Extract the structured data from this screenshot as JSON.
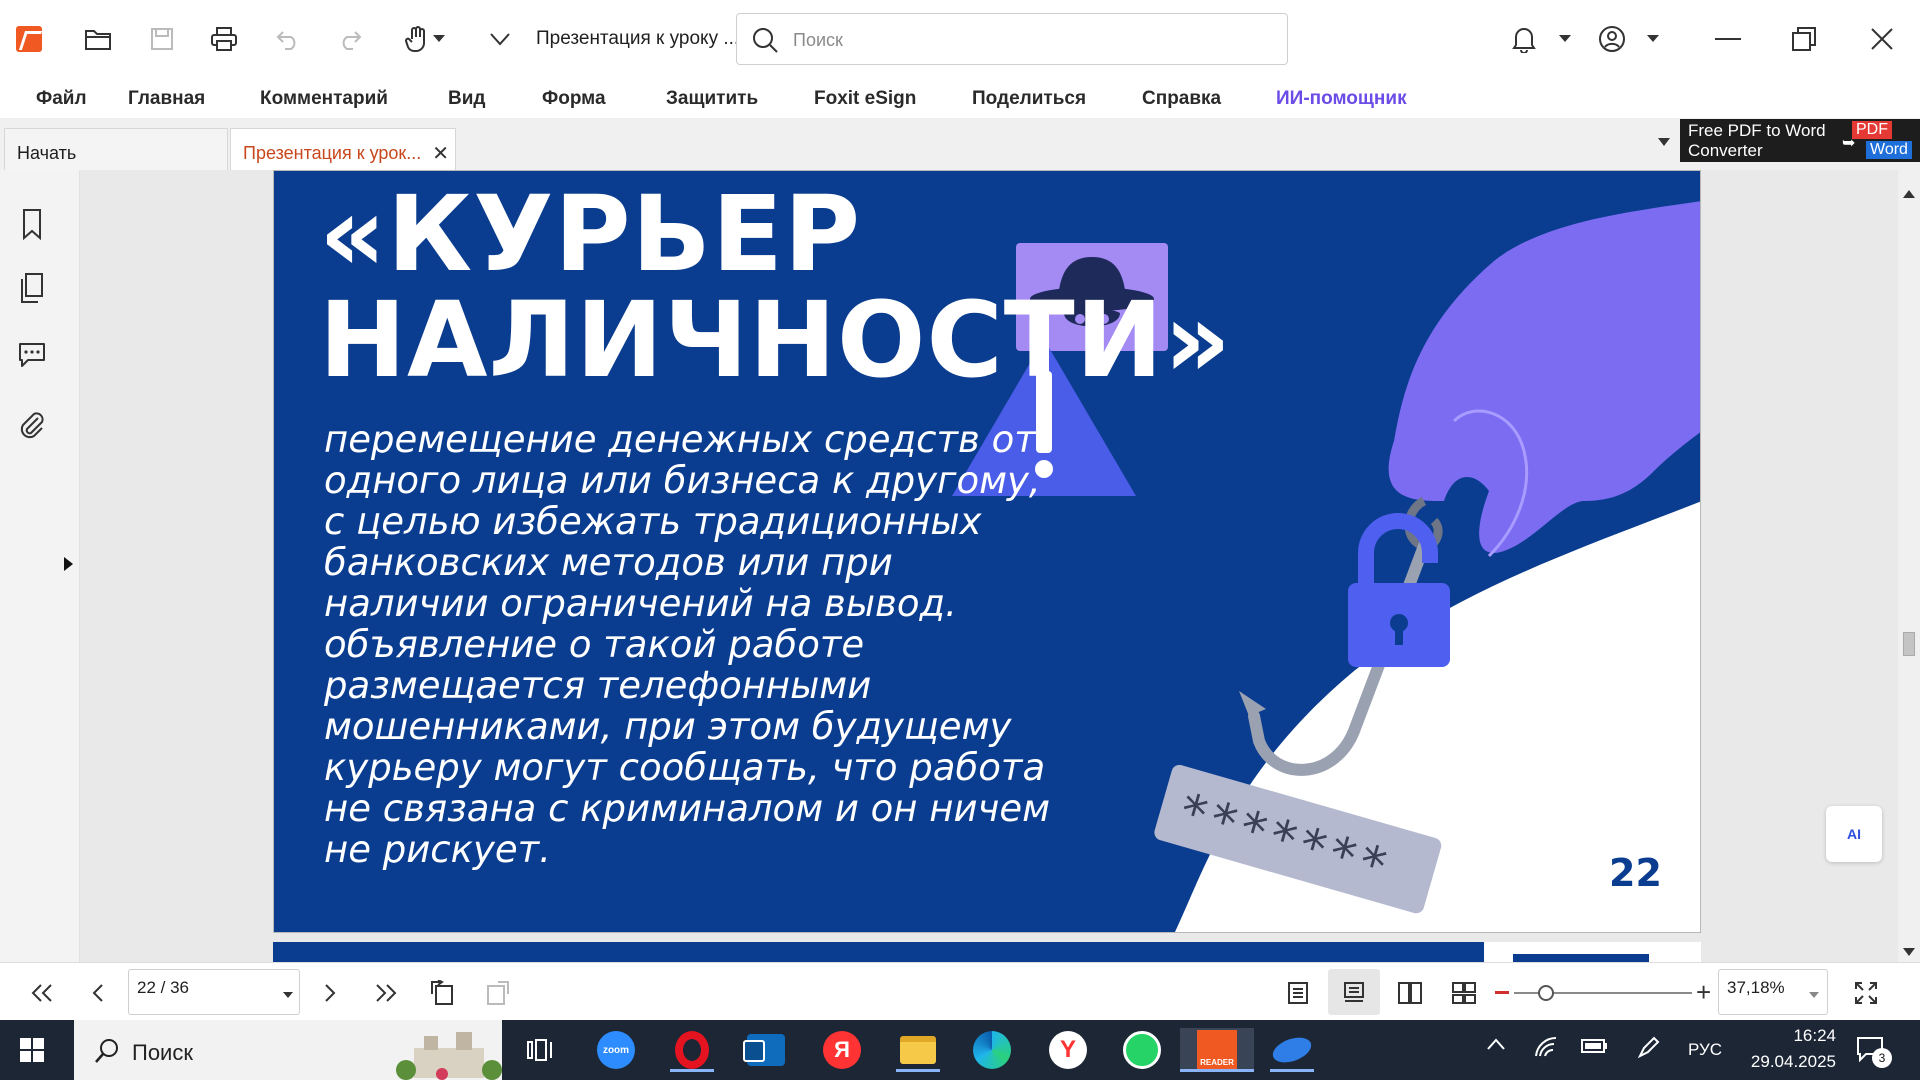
{
  "titlebar": {
    "document_title": "Презентация к уроку ...",
    "search_placeholder": "Поиск"
  },
  "menu": {
    "items": [
      "Файл",
      "Главная",
      "Комментарий",
      "Вид",
      "Форма",
      "Защитить",
      "Foxit eSign",
      "Поделиться",
      "Справка",
      "ИИ-помощник"
    ]
  },
  "tabs": [
    {
      "label": "Начать"
    },
    {
      "label": "Презентация к урок..."
    }
  ],
  "ad": {
    "text": "Free PDF to Word Converter",
    "pdf_label": "PDF",
    "word_label": "Word"
  },
  "slide": {
    "title_line1": "«КУРЬЕР",
    "title_line2": "НАЛИЧНОСТИ»",
    "body": "перемещение денежных средств от одного лица или бизнеса к другому, с целью избежать традиционных банковских методов или при наличии ограничений на вывод. объявление о такой работе размещается телефонными мошенниками, при этом будущему курьеру могут сообщать, что работа не связана с криминалом и он ничем не рискует.",
    "password_mask": "*******",
    "page_number": "22"
  },
  "ai_float": {
    "label": "AI"
  },
  "statusbar": {
    "page_indicator": "22 / 36",
    "zoom_value": "37,18%"
  },
  "taskbar": {
    "search_label": "Поиск",
    "language": "РУС",
    "time": "16:24",
    "date": "29.04.2025",
    "notification_count": "3",
    "zoom_label": "zoom",
    "reader_label": "READER"
  },
  "colors": {
    "slide_blue": "#0a3d8f",
    "accent_purple": "#7b6cf2",
    "foxit_orange": "#f05a22",
    "ai_purple": "#6b4ce6"
  }
}
